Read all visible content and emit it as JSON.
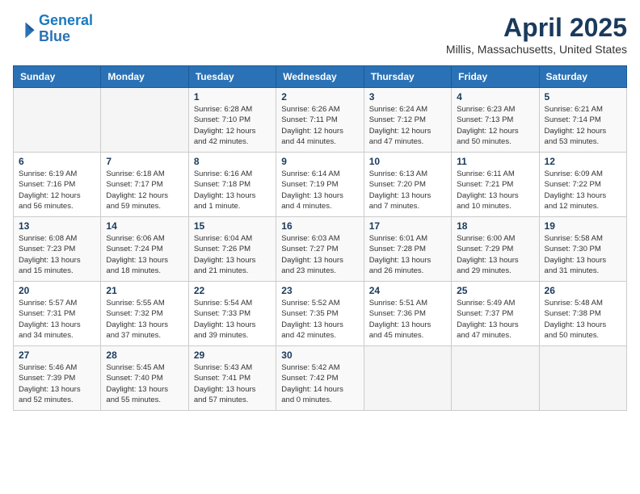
{
  "header": {
    "logo_line1": "General",
    "logo_line2": "Blue",
    "month": "April 2025",
    "location": "Millis, Massachusetts, United States"
  },
  "weekdays": [
    "Sunday",
    "Monday",
    "Tuesday",
    "Wednesday",
    "Thursday",
    "Friday",
    "Saturday"
  ],
  "weeks": [
    [
      {
        "day": "",
        "text": ""
      },
      {
        "day": "",
        "text": ""
      },
      {
        "day": "1",
        "text": "Sunrise: 6:28 AM\nSunset: 7:10 PM\nDaylight: 12 hours\nand 42 minutes."
      },
      {
        "day": "2",
        "text": "Sunrise: 6:26 AM\nSunset: 7:11 PM\nDaylight: 12 hours\nand 44 minutes."
      },
      {
        "day": "3",
        "text": "Sunrise: 6:24 AM\nSunset: 7:12 PM\nDaylight: 12 hours\nand 47 minutes."
      },
      {
        "day": "4",
        "text": "Sunrise: 6:23 AM\nSunset: 7:13 PM\nDaylight: 12 hours\nand 50 minutes."
      },
      {
        "day": "5",
        "text": "Sunrise: 6:21 AM\nSunset: 7:14 PM\nDaylight: 12 hours\nand 53 minutes."
      }
    ],
    [
      {
        "day": "6",
        "text": "Sunrise: 6:19 AM\nSunset: 7:16 PM\nDaylight: 12 hours\nand 56 minutes."
      },
      {
        "day": "7",
        "text": "Sunrise: 6:18 AM\nSunset: 7:17 PM\nDaylight: 12 hours\nand 59 minutes."
      },
      {
        "day": "8",
        "text": "Sunrise: 6:16 AM\nSunset: 7:18 PM\nDaylight: 13 hours\nand 1 minute."
      },
      {
        "day": "9",
        "text": "Sunrise: 6:14 AM\nSunset: 7:19 PM\nDaylight: 13 hours\nand 4 minutes."
      },
      {
        "day": "10",
        "text": "Sunrise: 6:13 AM\nSunset: 7:20 PM\nDaylight: 13 hours\nand 7 minutes."
      },
      {
        "day": "11",
        "text": "Sunrise: 6:11 AM\nSunset: 7:21 PM\nDaylight: 13 hours\nand 10 minutes."
      },
      {
        "day": "12",
        "text": "Sunrise: 6:09 AM\nSunset: 7:22 PM\nDaylight: 13 hours\nand 12 minutes."
      }
    ],
    [
      {
        "day": "13",
        "text": "Sunrise: 6:08 AM\nSunset: 7:23 PM\nDaylight: 13 hours\nand 15 minutes."
      },
      {
        "day": "14",
        "text": "Sunrise: 6:06 AM\nSunset: 7:24 PM\nDaylight: 13 hours\nand 18 minutes."
      },
      {
        "day": "15",
        "text": "Sunrise: 6:04 AM\nSunset: 7:26 PM\nDaylight: 13 hours\nand 21 minutes."
      },
      {
        "day": "16",
        "text": "Sunrise: 6:03 AM\nSunset: 7:27 PM\nDaylight: 13 hours\nand 23 minutes."
      },
      {
        "day": "17",
        "text": "Sunrise: 6:01 AM\nSunset: 7:28 PM\nDaylight: 13 hours\nand 26 minutes."
      },
      {
        "day": "18",
        "text": "Sunrise: 6:00 AM\nSunset: 7:29 PM\nDaylight: 13 hours\nand 29 minutes."
      },
      {
        "day": "19",
        "text": "Sunrise: 5:58 AM\nSunset: 7:30 PM\nDaylight: 13 hours\nand 31 minutes."
      }
    ],
    [
      {
        "day": "20",
        "text": "Sunrise: 5:57 AM\nSunset: 7:31 PM\nDaylight: 13 hours\nand 34 minutes."
      },
      {
        "day": "21",
        "text": "Sunrise: 5:55 AM\nSunset: 7:32 PM\nDaylight: 13 hours\nand 37 minutes."
      },
      {
        "day": "22",
        "text": "Sunrise: 5:54 AM\nSunset: 7:33 PM\nDaylight: 13 hours\nand 39 minutes."
      },
      {
        "day": "23",
        "text": "Sunrise: 5:52 AM\nSunset: 7:35 PM\nDaylight: 13 hours\nand 42 minutes."
      },
      {
        "day": "24",
        "text": "Sunrise: 5:51 AM\nSunset: 7:36 PM\nDaylight: 13 hours\nand 45 minutes."
      },
      {
        "day": "25",
        "text": "Sunrise: 5:49 AM\nSunset: 7:37 PM\nDaylight: 13 hours\nand 47 minutes."
      },
      {
        "day": "26",
        "text": "Sunrise: 5:48 AM\nSunset: 7:38 PM\nDaylight: 13 hours\nand 50 minutes."
      }
    ],
    [
      {
        "day": "27",
        "text": "Sunrise: 5:46 AM\nSunset: 7:39 PM\nDaylight: 13 hours\nand 52 minutes."
      },
      {
        "day": "28",
        "text": "Sunrise: 5:45 AM\nSunset: 7:40 PM\nDaylight: 13 hours\nand 55 minutes."
      },
      {
        "day": "29",
        "text": "Sunrise: 5:43 AM\nSunset: 7:41 PM\nDaylight: 13 hours\nand 57 minutes."
      },
      {
        "day": "30",
        "text": "Sunrise: 5:42 AM\nSunset: 7:42 PM\nDaylight: 14 hours\nand 0 minutes."
      },
      {
        "day": "",
        "text": ""
      },
      {
        "day": "",
        "text": ""
      },
      {
        "day": "",
        "text": ""
      }
    ]
  ]
}
